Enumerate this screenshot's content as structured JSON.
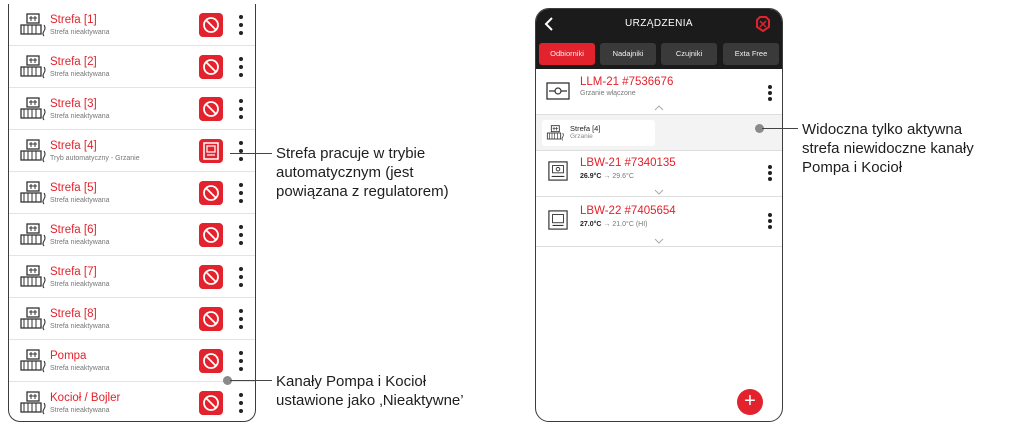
{
  "zones": [
    {
      "name": "Strefa [1]",
      "status": "Strefa nieaktywana",
      "mode": "inactive"
    },
    {
      "name": "Strefa [2]",
      "status": "Strefa nieaktywana",
      "mode": "inactive"
    },
    {
      "name": "Strefa [3]",
      "status": "Strefa nieaktywana",
      "mode": "inactive"
    },
    {
      "name": "Strefa [4]",
      "status": "Tryb automatyczny - Grzanie",
      "mode": "automatic"
    },
    {
      "name": "Strefa [5]",
      "status": "Strefa nieaktywana",
      "mode": "inactive"
    },
    {
      "name": "Strefa [6]",
      "status": "Strefa nieaktywana",
      "mode": "inactive"
    },
    {
      "name": "Strefa [7]",
      "status": "Strefa nieaktywana",
      "mode": "inactive"
    },
    {
      "name": "Strefa [8]",
      "status": "Strefa nieaktywana",
      "mode": "inactive"
    },
    {
      "name": "Pompa",
      "status": "Strefa nieaktywana",
      "mode": "inactive"
    },
    {
      "name": "Kocioł / Bojler",
      "status": "Strefa nieaktywana",
      "mode": "inactive"
    }
  ],
  "annotations": {
    "zone_active": "Strefa pracuje w trybie\nautomatycznym (jest\npowiązana z regulatorem)",
    "inactive_channels": "Kanały Pompa i Kocioł\nustawione jako ‚Nieaktywne’",
    "only_active_visible": "Widoczna tylko aktywna\nstrefa niewidoczne kanały\nPompa i Kocioł"
  },
  "app": {
    "title": "URZĄDZENIA",
    "tabs": [
      {
        "label": "Odbiorniki",
        "active": true
      },
      {
        "label": "Nadajniki",
        "active": false
      },
      {
        "label": "Czujniki",
        "active": false
      },
      {
        "label": "Exta Free",
        "active": false
      }
    ],
    "devices": [
      {
        "name": "LLM-21 #7536676",
        "status": "Grzanie włączone",
        "icon": "receiver-module-icon"
      },
      {
        "name": "LBW-21 #7340135",
        "temp_current": "26.9°C",
        "temp_arrow": "→",
        "temp_target": "29.6°C",
        "icon": "thermostat-panel-icon"
      },
      {
        "name": "LBW-22 #7405654",
        "temp_current": "27.0°C",
        "temp_arrow": "→",
        "temp_target": "21.0°C (HI)",
        "icon": "thermostat-screen-icon"
      }
    ],
    "active_channel": {
      "name": "Strefa [4]",
      "status": "Grzanie"
    },
    "add_button_label": "+"
  },
  "colors": {
    "accent_red": "#e2222c",
    "header_dark": "#1b1b1b",
    "tab_inactive": "#3a3a3a"
  }
}
